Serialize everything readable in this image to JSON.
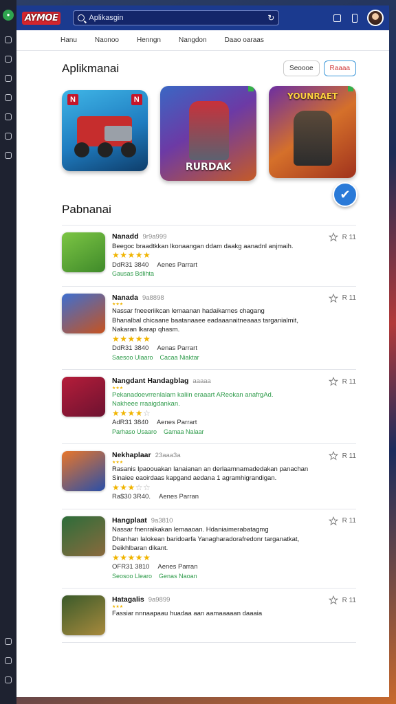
{
  "brand": {
    "logo_text": "AYMOE"
  },
  "search": {
    "placeholder": "Aplikasgin"
  },
  "nav": {
    "tabs": [
      "Hanu",
      "Naonoo",
      "Henngn",
      "Nangdon",
      "Daao oaraas"
    ]
  },
  "featured": {
    "title": "Aplikmanai",
    "buttons": [
      "Seoooe",
      "Raaaa"
    ],
    "cards": [
      {
        "corner_left": "N",
        "corner_right": "N"
      },
      {
        "banner": "RURDAK"
      },
      {
        "banner": "YOUNRAET"
      }
    ]
  },
  "section2": {
    "title": "Pabnanai"
  },
  "apps": [
    {
      "name": "Nanadd",
      "meta": "9r9a999",
      "desc": [
        "Beegoc braadtkkan lkonaangan ddam daakg aanadnl anjmaih."
      ],
      "desc_green": false,
      "mini_stars": false,
      "stars": 4.5,
      "price": "DdR31 3840",
      "dev": "Aenes Parrart",
      "tags": [
        "Gausas Bdlihta",
        ""
      ],
      "rating_text": "R 11",
      "top": 0
    },
    {
      "name": "Nanada",
      "meta": "9a8898",
      "desc": [
        "Nassar fneeeriikcan lemaanan hadaikarnes chagang",
        "Bhanalbal chicaane baatanaaee eadaaanaitneaaas targanialmit,",
        "Nakaran lkarap qhasm."
      ],
      "desc_green": false,
      "mini_stars": true,
      "stars": 4.5,
      "price": "DdR31 3840",
      "dev": "Aenas Parrart",
      "tags": [
        "Saesoo Ulaaro",
        "Cacaa Niaktar"
      ],
      "rating_text": "R 11"
    },
    {
      "name": "Nangdant Handagblag",
      "meta": "aaaaa",
      "desc": [
        "Pekanadoevrrenlalam kaliin eraaart AReokan anafrgAd.",
        "Nakheee rraaigdankan."
      ],
      "desc_green": true,
      "mini_stars": true,
      "stars": 3.5,
      "price": "AdR31 3840",
      "dev": "Aenes Parrart",
      "tags": [
        "Parhaso Usaaro",
        "Gamaa Nalaar"
      ],
      "rating_text": "R 11"
    },
    {
      "name": "Nekhaplaar",
      "meta": "23aaa3a",
      "desc": [
        "Rasanis Ipaoouakan lanaianan an derlaamnamadedakan panachan",
        "Sinaiee eaoirdaas kapgand aedana 1 agramhigrandigan."
      ],
      "desc_green": false,
      "mini_stars": true,
      "stars": 2.5,
      "price": "Ra$30 3R40.",
      "dev": "Aenes Parran",
      "tags": [],
      "rating_text": "R 11"
    },
    {
      "name": "Hangplaat",
      "meta": "9a3810",
      "desc": [
        "Nassar fnenraikakan lemaaoan. Hdaniaimerabatagmg",
        "Dhanhan lalokean baridoarfa Yanagharadorafredonr targanatkat,",
        "Deikhlbaran dikant."
      ],
      "desc_green": false,
      "mini_stars": false,
      "stars": 4.5,
      "price": "OFR31 3810",
      "dev": "Aenes Parran",
      "tags": [
        "Seosoo Llearo",
        "Genas Naoan"
      ],
      "rating_text": "R 11"
    },
    {
      "name": "Hatagalis",
      "meta": "9a9899",
      "desc": [
        "Fassiar nnnaapaau huadaa aan aamaaaaan daaaia"
      ],
      "desc_green": false,
      "mini_stars": true,
      "stars": null,
      "price": "",
      "dev": "",
      "tags": [],
      "rating_text": "R 11"
    }
  ],
  "colors": {
    "accent": "#1b3a8f",
    "star": "#f0b400",
    "green": "#2e9b4a",
    "check": "#2a7ad8"
  }
}
